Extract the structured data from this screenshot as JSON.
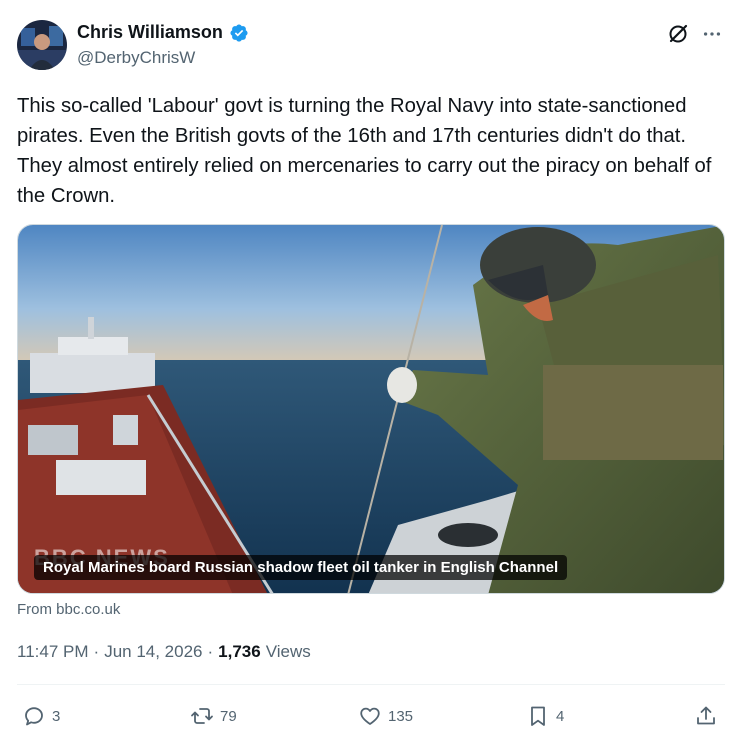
{
  "author": {
    "display_name": "Chris Williamson",
    "handle": "@DerbyChrisW",
    "verified": true,
    "verified_color": "#1d9bf0"
  },
  "header_icons": {
    "grok": "grok-icon",
    "more": "more-icon"
  },
  "tweet": {
    "text": "This so-called 'Labour' govt is turning the Royal Navy into state-sanctioned pirates. Even the British govts of the 16th and 17th centuries didn't do that. They almost entirely relied on mercenaries to carry out the piracy on behalf of the Crown."
  },
  "media": {
    "caption": "Royal Marines board Russian shadow fleet oil tanker in English Channel",
    "watermark": "BBC NEWS",
    "source": "From bbc.co.uk"
  },
  "meta": {
    "time": "11:47 PM",
    "date": "Jun 14, 2026",
    "separator": "·",
    "views_count": "1,736",
    "views_label": "Views"
  },
  "actions": {
    "replies": "3",
    "reposts": "79",
    "likes": "135",
    "bookmarks": "4"
  },
  "colors": {
    "text_primary": "#0f1419",
    "text_secondary": "#536471",
    "divider": "#eff3f4"
  }
}
